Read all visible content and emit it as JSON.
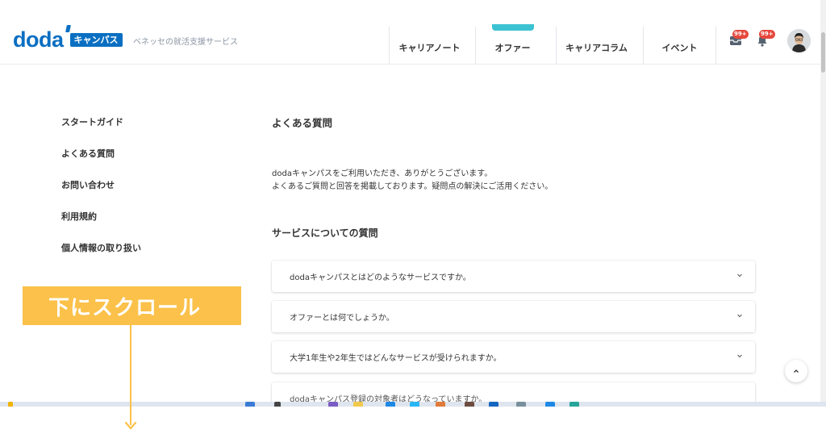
{
  "header": {
    "logo_word": "doda",
    "logo_box": "キャンパス",
    "tagline": "ベネッセの就活支援サービス",
    "nav": [
      "キャリアノート",
      "オファー",
      "キャリアコラム",
      "イベント"
    ],
    "message_badge": "99+",
    "notification_badge": "99+"
  },
  "sidebar": {
    "items": [
      "スタートガイド",
      "よくある質問",
      "お問い合わせ",
      "利用規約",
      "個人情報の取り扱い"
    ]
  },
  "main": {
    "title": "よくある質問",
    "intro_lines": [
      "dodaキャンパスをご利用いただき、ありがとうございます。",
      "よくあるご質問と回答を掲載しております。疑問点の解決にご活用ください。"
    ],
    "section_title": "サービスについての質問",
    "faqs": [
      "dodaキャンパスとはどのようなサービスですか。",
      "オファーとは何でしょうか。",
      "大学1年生や2年生ではどんなサービスが受けられますか。",
      "dodaキャンパス登録の対象者はどうなっていますか。"
    ]
  },
  "overlay": {
    "scroll_hint": "下にスクロール"
  },
  "icons": {
    "message": "mailbox-icon",
    "notification": "bell-icon",
    "chevron": "chevron-down-icon",
    "back_to_top": "chevron-up-icon"
  },
  "colors": {
    "brand": "#0a6fc2",
    "badge": "#e6483d",
    "accent_tab": "#3cc3d3",
    "annotation": "#fbc14a"
  }
}
